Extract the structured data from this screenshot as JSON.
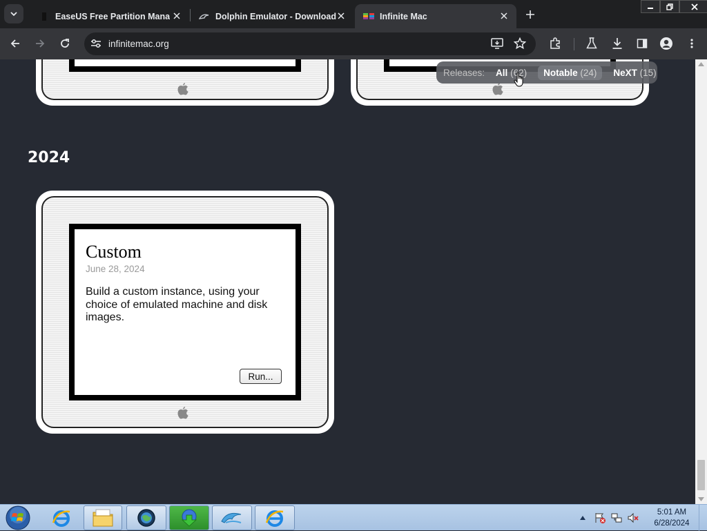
{
  "browser": {
    "tabs": [
      {
        "title": "EaseUS Free Partition Manager",
        "favicon": "easeus-icon",
        "active": false
      },
      {
        "title": "Dolphin Emulator - Download",
        "favicon": "dolphin-icon",
        "active": false
      },
      {
        "title": "Infinite Mac",
        "favicon": "infinite-mac-icon",
        "active": true
      }
    ],
    "url": "infinitemac.org"
  },
  "page": {
    "releases_filter": {
      "label": "Releases:",
      "options": [
        {
          "name": "All",
          "count": "(62)",
          "selected": false
        },
        {
          "name": "Notable",
          "count": "(24)",
          "selected": true
        },
        {
          "name": "NeXT",
          "count": "(15)",
          "selected": false
        }
      ]
    },
    "year_heading": "2024",
    "card": {
      "title": "Custom",
      "date": "June 28, 2024",
      "description": "Build a custom instance, using your choice of emulated machine and disk images.",
      "run_label": "Run..."
    }
  },
  "taskbar": {
    "apps": [
      "internet-explorer-icon",
      "windows-explorer-icon",
      "globe-app-icon",
      "idm-icon",
      "dolphin-app-icon",
      "internet-explorer-icon"
    ],
    "time": "5:01 AM",
    "date": "6/28/2024"
  },
  "colors": {
    "page_bg": "#262a33",
    "tabstrip_bg": "#1f2022",
    "toolbar_bg": "#35363a"
  }
}
